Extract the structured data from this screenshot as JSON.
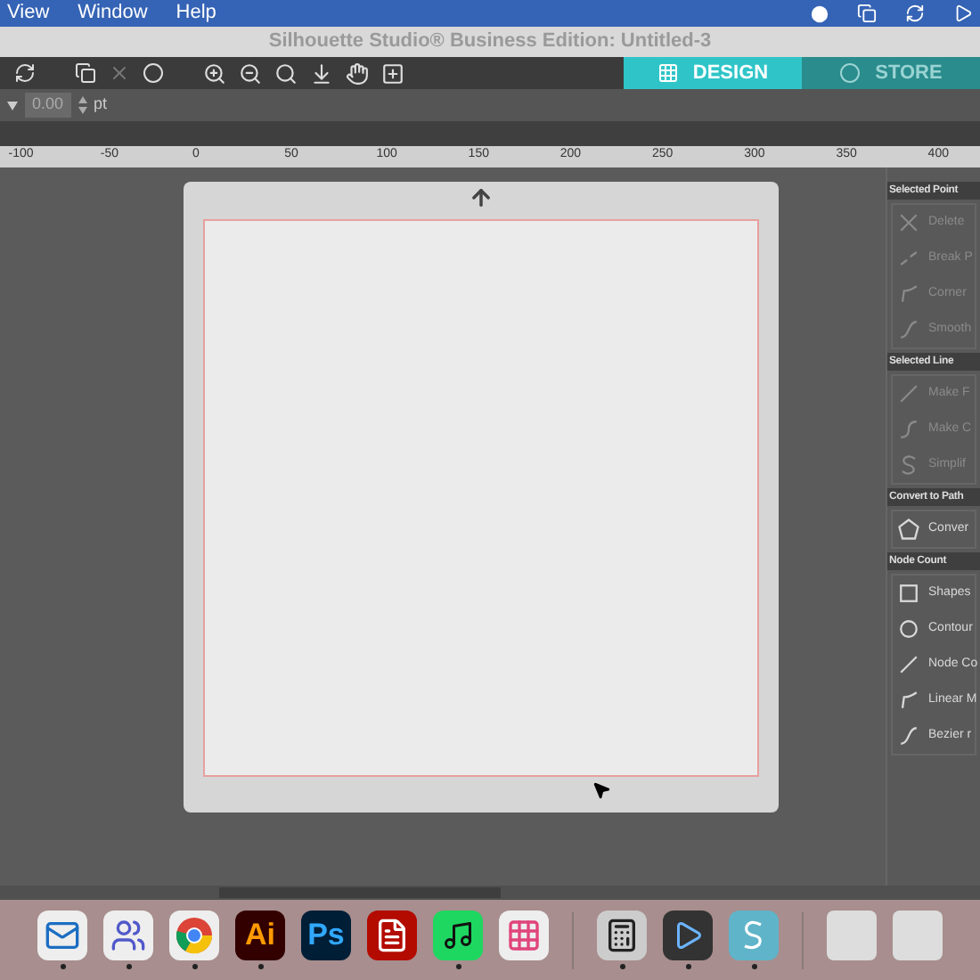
{
  "menu_bar": {
    "items": [
      "View",
      "Window",
      "Help"
    ]
  },
  "window": {
    "title": "Silhouette Studio® Business Edition: Untitled-3"
  },
  "tabs": [
    {
      "label": "DESIGN",
      "selected": true
    },
    {
      "label": "STORE",
      "selected": false
    }
  ],
  "options": {
    "value": "0.00",
    "unit": "pt"
  },
  "ruler": {
    "labels": [
      "-100",
      "-50",
      "0",
      "50",
      "100",
      "150",
      "200",
      "250",
      "300",
      "350",
      "400"
    ]
  },
  "panel": {
    "sections": [
      {
        "title": "Selected Point",
        "items": [
          {
            "label": "Delete",
            "disabled": true,
            "kind": "x"
          },
          {
            "label": "Break P",
            "disabled": true,
            "kind": "break"
          },
          {
            "label": "Corner",
            "disabled": true,
            "kind": "corner"
          },
          {
            "label": "Smooth",
            "disabled": true,
            "kind": "smooth"
          }
        ]
      },
      {
        "title": "Selected Line",
        "items": [
          {
            "label": "Make F",
            "disabled": true,
            "kind": "line"
          },
          {
            "label": "Make C",
            "disabled": true,
            "kind": "curve"
          },
          {
            "label": "Simplif",
            "disabled": true,
            "kind": "s"
          }
        ]
      },
      {
        "title": "Convert to Path",
        "items": [
          {
            "label": "Conver",
            "disabled": false,
            "kind": "pentagon"
          }
        ]
      },
      {
        "title": "Node Count",
        "items": [
          {
            "label": "Shapes",
            "disabled": false,
            "kind": "square"
          },
          {
            "label": "Contour",
            "disabled": false,
            "kind": "circle"
          },
          {
            "label": "Node Co",
            "disabled": false,
            "kind": "line"
          },
          {
            "label": "Linear M",
            "disabled": false,
            "kind": "corner"
          },
          {
            "label": "Bezier r",
            "disabled": false,
            "kind": "smooth"
          }
        ]
      }
    ]
  },
  "dock": [
    {
      "kind": "mail",
      "running": true
    },
    {
      "kind": "team",
      "running": true
    },
    {
      "kind": "browser",
      "running": true
    },
    {
      "kind": "text",
      "label": "Ai",
      "running": true
    },
    {
      "kind": "text",
      "label": "Ps",
      "running": false
    },
    {
      "kind": "pdf",
      "running": false
    },
    {
      "kind": "music",
      "running": true
    },
    {
      "kind": "grid",
      "running": false
    },
    {
      "kind": "sep"
    },
    {
      "kind": "calc",
      "running": true
    },
    {
      "kind": "player",
      "running": true
    },
    {
      "kind": "silhouette",
      "running": true
    },
    {
      "kind": "sep"
    },
    {
      "kind": "window",
      "running": false
    },
    {
      "kind": "window",
      "running": false
    }
  ]
}
